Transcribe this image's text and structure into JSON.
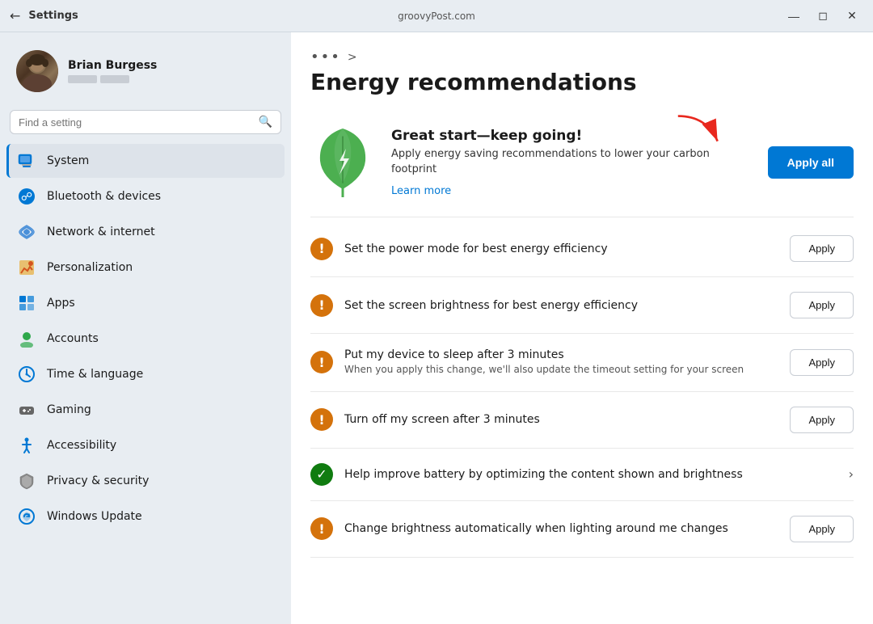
{
  "titlebar": {
    "app_title": "Settings",
    "site_label": "groovyPost.com",
    "back_icon": "←",
    "minimize_icon": "—",
    "maximize_icon": "☐",
    "close_icon": "✕"
  },
  "sidebar": {
    "search_placeholder": "Find a setting",
    "user": {
      "name": "Brian Burgess"
    },
    "items": [
      {
        "id": "system",
        "label": "System",
        "icon": "system",
        "active": true
      },
      {
        "id": "bluetooth",
        "label": "Bluetooth & devices",
        "icon": "bluetooth"
      },
      {
        "id": "network",
        "label": "Network & internet",
        "icon": "network"
      },
      {
        "id": "personalization",
        "label": "Personalization",
        "icon": "personalization"
      },
      {
        "id": "apps",
        "label": "Apps",
        "icon": "apps"
      },
      {
        "id": "accounts",
        "label": "Accounts",
        "icon": "accounts"
      },
      {
        "id": "time",
        "label": "Time & language",
        "icon": "time"
      },
      {
        "id": "gaming",
        "label": "Gaming",
        "icon": "gaming"
      },
      {
        "id": "accessibility",
        "label": "Accessibility",
        "icon": "accessibility"
      },
      {
        "id": "privacy",
        "label": "Privacy & security",
        "icon": "privacy"
      },
      {
        "id": "windows-update",
        "label": "Windows Update",
        "icon": "update"
      }
    ]
  },
  "content": {
    "breadcrumb_dots": "•••",
    "breadcrumb_arrow": ">",
    "page_title": "Energy recommendations",
    "banner": {
      "title": "Great start—keep going!",
      "description": "Apply energy saving recommendations to lower your carbon footprint",
      "link_text": "Learn more",
      "apply_all_label": "Apply all"
    },
    "recommendations": [
      {
        "id": "power-mode",
        "icon_type": "warning",
        "icon_char": "!",
        "title": "Set the power mode for best energy efficiency",
        "subtitle": "",
        "action_type": "button",
        "action_label": "Apply"
      },
      {
        "id": "screen-brightness",
        "icon_type": "warning",
        "icon_char": "!",
        "title": "Set the screen brightness for best energy efficiency",
        "subtitle": "",
        "action_type": "button",
        "action_label": "Apply"
      },
      {
        "id": "sleep-timer",
        "icon_type": "warning",
        "icon_char": "!",
        "title": "Put my device to sleep after 3 minutes",
        "subtitle": "When you apply this change, we'll also update the timeout setting for your screen",
        "action_type": "button",
        "action_label": "Apply"
      },
      {
        "id": "screen-off",
        "icon_type": "warning",
        "icon_char": "!",
        "title": "Turn off my screen after 3 minutes",
        "subtitle": "",
        "action_type": "button",
        "action_label": "Apply"
      },
      {
        "id": "battery-optimize",
        "icon_type": "success",
        "icon_char": "✓",
        "title": "Help improve battery by optimizing the content shown and brightness",
        "subtitle": "",
        "action_type": "chevron",
        "action_label": "›"
      },
      {
        "id": "auto-brightness",
        "icon_type": "warning",
        "icon_char": "!",
        "title": "Change brightness automatically when lighting around me changes",
        "subtitle": "",
        "action_type": "button",
        "action_label": "Apply"
      }
    ]
  }
}
